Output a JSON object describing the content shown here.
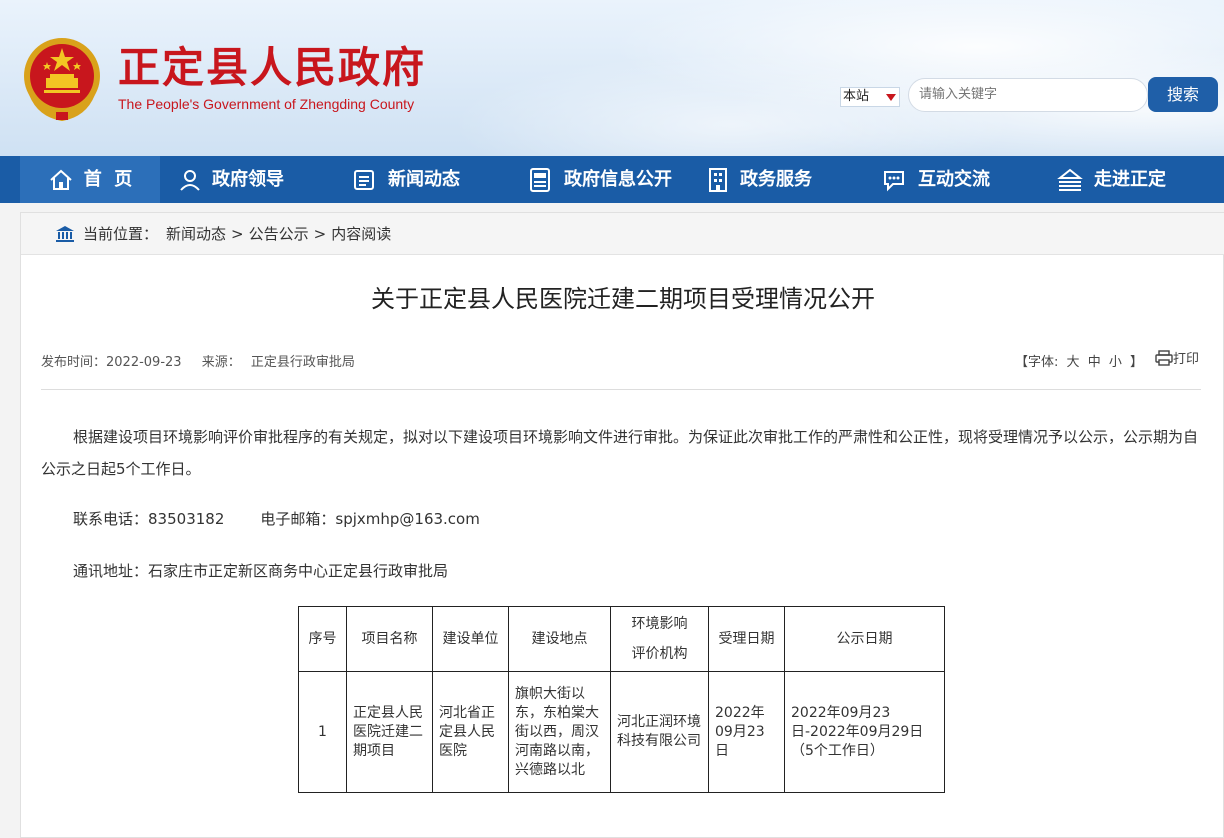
{
  "header": {
    "title": "正定县人民政府",
    "subtitle": "The People's Government of Zhengding County",
    "search_scope": "本站",
    "search_placeholder": "请输入关键字",
    "search_button": "搜索"
  },
  "nav": {
    "items": [
      {
        "label": "首  页",
        "icon": "home-icon"
      },
      {
        "label": "政府领导",
        "icon": "person-icon"
      },
      {
        "label": "新闻动态",
        "icon": "news-icon"
      },
      {
        "label": "政府信息公开",
        "icon": "newspaper-icon"
      },
      {
        "label": "政务服务",
        "icon": "building-icon"
      },
      {
        "label": "互动交流",
        "icon": "chat-icon"
      },
      {
        "label": "走进正定",
        "icon": "landmark-icon"
      }
    ]
  },
  "breadcrumb": {
    "prefix": "当前位置：",
    "items": [
      "新闻动态",
      "公告公示",
      "内容阅读"
    ],
    "separator": ">"
  },
  "article": {
    "title": "关于正定县人民医院迁建二期项目受理情况公开",
    "publish_label": "发布时间：",
    "publish_date": "2022-09-23",
    "source_label": "来源：",
    "source": "正定县行政审批局",
    "font_ctrl_prefix": "【字体:",
    "font_large": "大",
    "font_medium": "中",
    "font_small": "小",
    "font_ctrl_suffix": "】",
    "print_label": "打印",
    "intro": "根据建设项目环境影响评价审批程序的有关规定，拟对以下建设项目环境影响文件进行审批。为保证此次审批工作的严肃性和公正性，现将受理情况予以公示，公示期为自公示之日起5个工作日。",
    "phone_label": "联系电话：",
    "phone": "83503182",
    "email_label": "电子邮箱：",
    "email": "spjxmhp@163.com",
    "address_label": "通讯地址：",
    "address": "石家庄市正定新区商务中心正定县行政审批局"
  },
  "table": {
    "headers": [
      "序号",
      "项目名称",
      "建设单位",
      "建设地点",
      "环境影响评价机构",
      "受理日期",
      "公示日期"
    ],
    "header_env_line1": "环境影响",
    "header_env_line2": "评价机构",
    "row": {
      "no": "1",
      "project": "正定县人民医院迁建二期项目",
      "unit": "河北省正定县人民医院",
      "location": "旗帜大街以东，东柏棠大街以西，周汉河南路以南，兴德路以北",
      "agency": "河北正润环境科技有限公司",
      "accept_date": "2022年09月23日",
      "notice_date": "2022年09月23日-2022年09月29日（5个工作日）"
    }
  },
  "colors": {
    "brand_red": "#c8161d",
    "nav_blue": "#1a5ca6",
    "nav_active": "#2c6fb9",
    "search_blue": "#1f5fa8"
  }
}
